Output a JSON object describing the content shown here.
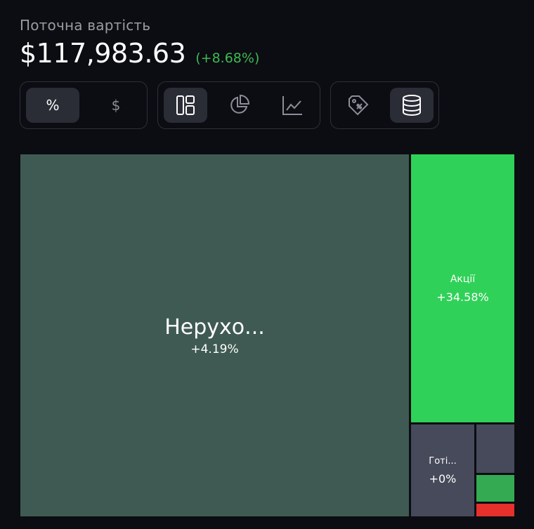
{
  "header": {
    "subtitle": "Поточна вартість",
    "value": "$117,983.63",
    "change": "(+8.68%)",
    "change_color": "#3fb950"
  },
  "toggles": {
    "unit_group": [
      {
        "label": "%",
        "active": true
      },
      {
        "label": "$",
        "active": false
      }
    ],
    "view_group": [
      {
        "icon": "treemap-icon",
        "active": true
      },
      {
        "icon": "pie-chart-icon",
        "active": false
      },
      {
        "icon": "line-chart-icon",
        "active": false
      }
    ],
    "grouping_group": [
      {
        "icon": "tag-icon",
        "active": false
      },
      {
        "icon": "database-icon",
        "active": true
      }
    ]
  },
  "treemap": {
    "tiles": [
      {
        "name": "Нерухо...",
        "change": "+4.19%",
        "color": "#3f5a52"
      },
      {
        "name": "Акції",
        "change": "+34.58%",
        "color": "#30d158"
      },
      {
        "name": "Готі...",
        "change": "+0%",
        "color": "#464a5a"
      },
      {
        "name": "",
        "change": "",
        "color": "#464a5a"
      },
      {
        "name": "",
        "change": "",
        "color": "#34aa52"
      },
      {
        "name": "",
        "change": "",
        "color": "#e5302c"
      }
    ]
  }
}
